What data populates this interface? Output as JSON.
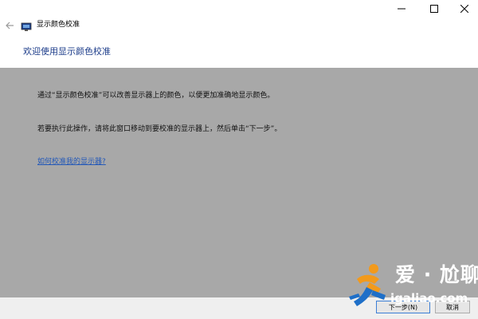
{
  "window": {
    "title": "显示颜色校准"
  },
  "header": {
    "title": "欢迎使用显示颜色校准"
  },
  "content": {
    "paragraph1": "通过“显示颜色校准”可以改善显示器上的颜色，以便更加准确地显示颜色。",
    "paragraph2": "若要执行此操作，请将此窗口移动到要校准的显示器上，然后单击“下一步”。",
    "help_link": "如何校准我的显示器?"
  },
  "footer": {
    "next_label": "下一步(N)",
    "cancel_label": "取消"
  },
  "watermark": {
    "text_cn": "爱 · 尬聊",
    "text_url": "igaliao.com"
  },
  "icons": {
    "back": "back-arrow-icon",
    "app": "display-icon",
    "minimize": "minimize-icon",
    "maximize": "maximize-icon",
    "close": "close-icon"
  },
  "colors": {
    "header_text": "#1c3c8a",
    "panel_bg": "#a8a8a8",
    "link": "#2358b8",
    "watermark_orange": "#f29a1c",
    "watermark_blue": "#1e6fc8"
  }
}
